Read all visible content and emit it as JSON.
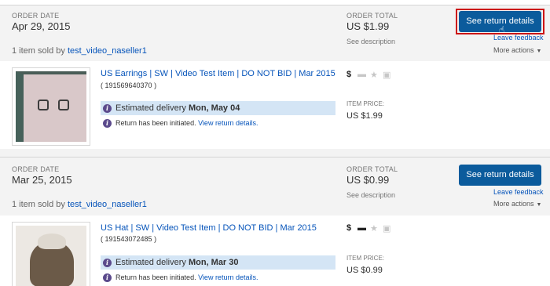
{
  "orders": [
    {
      "order_date_label": "ORDER DATE",
      "order_date": "Apr 29, 2015",
      "sold_prefix": "1 item sold by",
      "seller": "test_video_naseller1",
      "order_total_label": "ORDER TOTAL",
      "order_total": "US $1.99",
      "see_description": "See description",
      "primary_button": "See return details",
      "leave_feedback": "Leave feedback",
      "more_actions": "More actions",
      "item": {
        "title": "US Earrings | SW | Video Test Item | DO NOT BID | Mar 2015",
        "item_number": "( 191569640370 )",
        "estimated_label": "Estimated delivery",
        "estimated_date": "Mon, May 04",
        "return_text": "Return has been initiated.",
        "return_link": "View return details.",
        "price_label": "ITEM PRICE:",
        "price": "US $1.99"
      }
    },
    {
      "order_date_label": "ORDER DATE",
      "order_date": "Mar 25, 2015",
      "sold_prefix": "1 item sold by",
      "seller": "test_video_naseller1",
      "order_total_label": "ORDER TOTAL",
      "order_total": "US $0.99",
      "see_description": "See description",
      "primary_button": "See return details",
      "leave_feedback": "Leave feedback",
      "more_actions": "More actions",
      "item": {
        "title": "US Hat | SW | Video Test Item | DO NOT BID | Mar 2015",
        "item_number": "( 191543072485 )",
        "estimated_label": "Estimated delivery",
        "estimated_date": "Mon, Mar 30",
        "return_text": "Return has been initiated.",
        "return_link": "View return details.",
        "price_label": "ITEM PRICE:",
        "price": "US $0.99"
      }
    }
  ],
  "icons": {
    "status": [
      "dollar-icon",
      "shipping-icon",
      "feedback-star-icon",
      "delivered-box-icon"
    ],
    "info": "info-icon",
    "chevron": "chevron-down-icon",
    "cursor": "hand-pointer-icon"
  },
  "colors": {
    "primary_button": "#0b5b9c",
    "highlight_outline": "#cc1414",
    "link": "#0654ba",
    "estimated_bg": "#d4e5f5",
    "info_icon": "#5b4a8c"
  }
}
